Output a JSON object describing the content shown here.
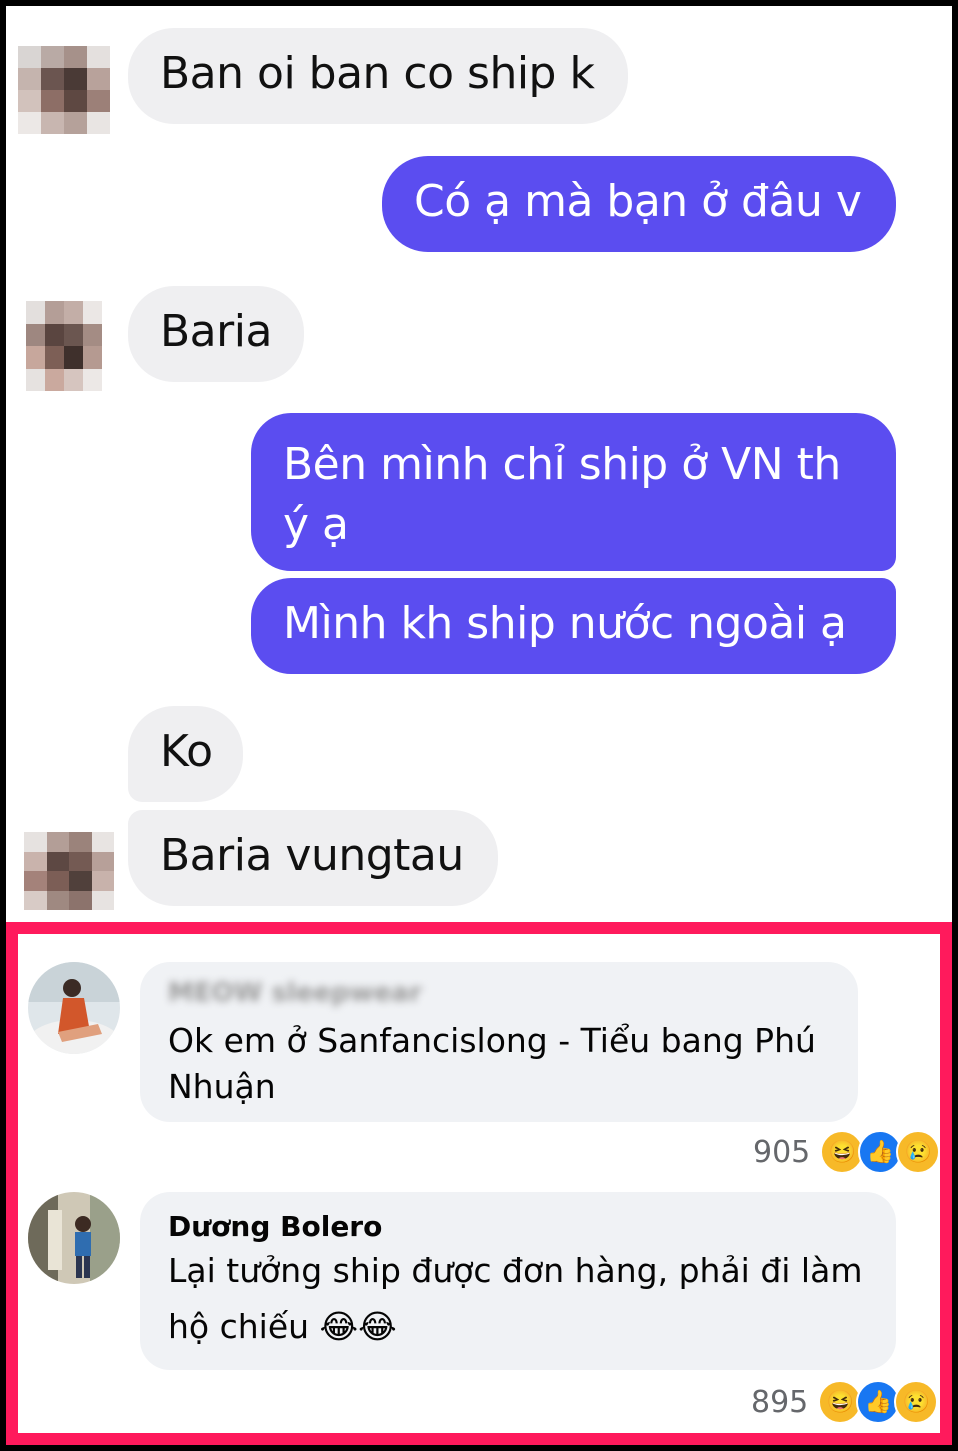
{
  "chat": {
    "messages": [
      {
        "side": "recv",
        "text": "Ban oi ban co ship k"
      },
      {
        "side": "sent",
        "text": "Có ạ mà bạn ở đâu v"
      },
      {
        "side": "recv",
        "text": "Baria"
      },
      {
        "side": "sent",
        "line1": "Bên mình chỉ ship ở VN th",
        "line2": "ý ạ"
      },
      {
        "side": "sent",
        "text": "Mình kh ship nước ngoài ạ"
      },
      {
        "side": "recv",
        "text": "Ko"
      },
      {
        "side": "recv",
        "text": "Baria vungtau"
      }
    ]
  },
  "comments": [
    {
      "author": "MEOW sleepwear",
      "author_blurred": true,
      "line1": "Ok em ở Sanfancislong - Tiểu bang Phú",
      "line2": "Nhuận",
      "reaction_count": "905",
      "reactions": [
        "haha",
        "like",
        "sad"
      ]
    },
    {
      "author": "Dương Bolero",
      "author_blurred": false,
      "line1": "Lại tưởng ship được đơn hàng, phải đi làm",
      "line2": "hộ chiếu",
      "line2_emoji": "😂😂",
      "reaction_count": "895",
      "reactions": [
        "haha",
        "like",
        "sad"
      ]
    }
  ],
  "colors": {
    "sent_bubble": "#5b4df0",
    "recv_bubble": "#efeff1",
    "highlight_border": "#ff1a5c",
    "comment_bubble": "#f0f2f5"
  }
}
